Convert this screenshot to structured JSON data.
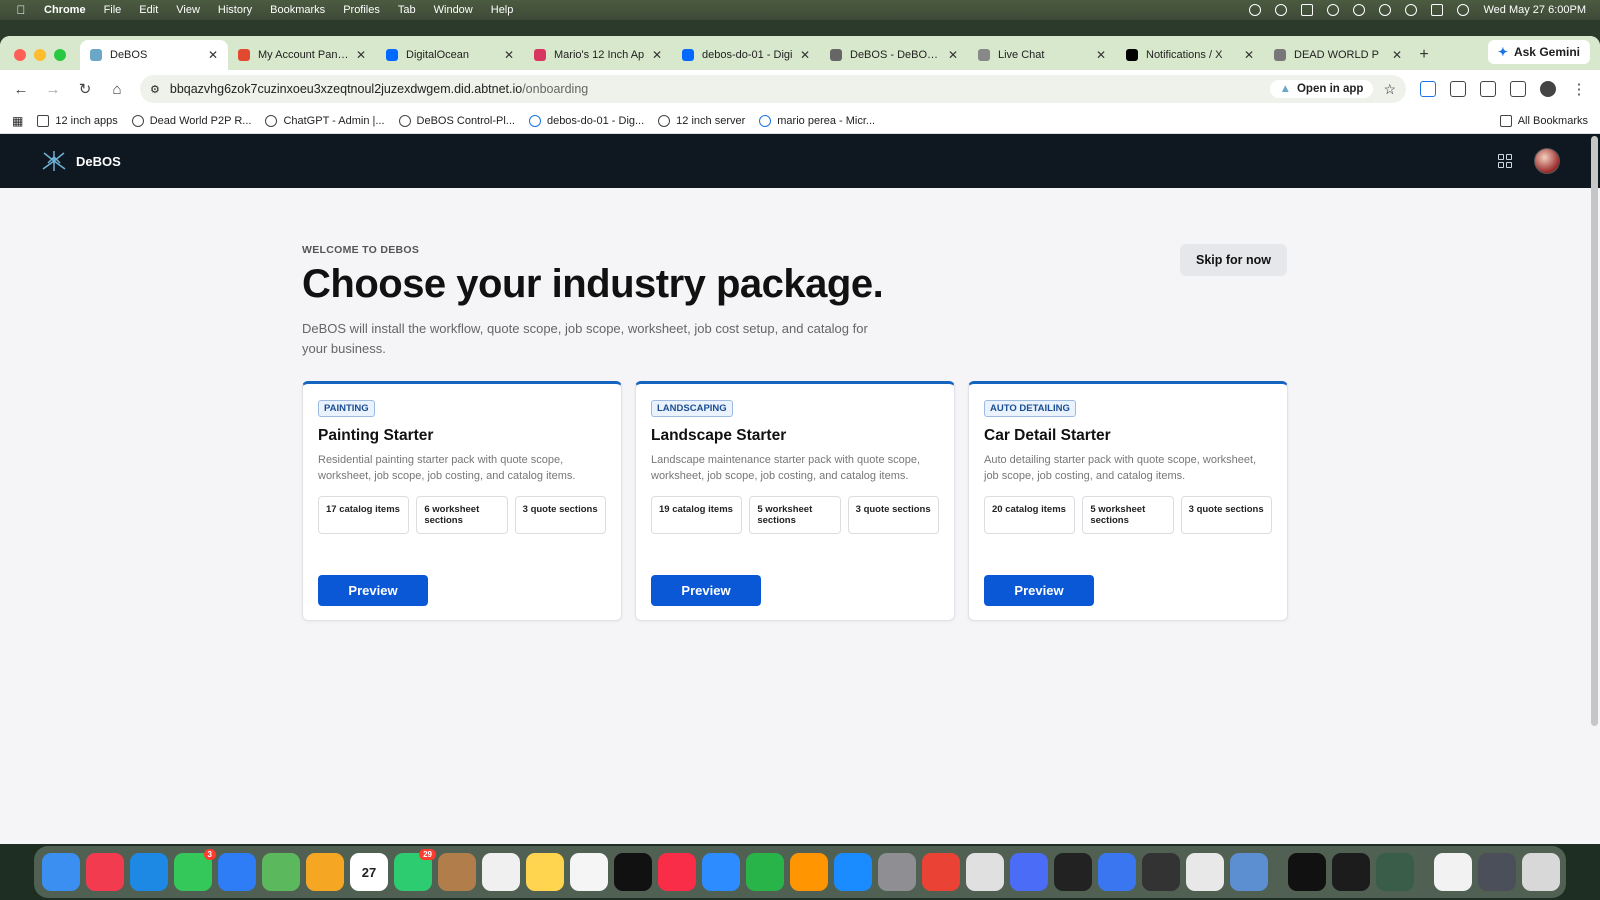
{
  "menubar": {
    "app": "Chrome",
    "items": [
      "File",
      "Edit",
      "View",
      "History",
      "Bookmarks",
      "Profiles",
      "Tab",
      "Window",
      "Help"
    ],
    "datetime": "Wed May 27  6:00PM"
  },
  "tabs": [
    {
      "label": "DeBOS",
      "color": "#6aa7c9"
    },
    {
      "label": "My Account Panel -",
      "color": "#e24a2f"
    },
    {
      "label": "DigitalOcean",
      "color": "#0069ff"
    },
    {
      "label": "Mario's 12 Inch Ap",
      "color": "#d8365f"
    },
    {
      "label": "debos-do-01 - Digi",
      "color": "#0069ff"
    },
    {
      "label": "DeBOS - DeBOS W",
      "color": "#666666"
    },
    {
      "label": "Live Chat",
      "color": "#888888"
    },
    {
      "label": "Notifications / X",
      "color": "#000000"
    },
    {
      "label": "DEAD WORLD P",
      "color": "#777777"
    }
  ],
  "gemini_label": "Ask Gemini",
  "toolbar": {
    "url": "bbqazvhg6zok7cuzinxoeu3xzeqtnoul2juzexdwgem.did.abtnet.io",
    "url_path": "/onboarding",
    "open_in_app": "Open in app"
  },
  "bookmarks": [
    {
      "label": "12 inch apps",
      "icon": "folder"
    },
    {
      "label": "Dead World P2P R...",
      "icon": "globe"
    },
    {
      "label": "ChatGPT - Admin |...",
      "icon": "globe"
    },
    {
      "label": "DeBOS Control-Pl...",
      "icon": "globe"
    },
    {
      "label": "debos-do-01 - Dig...",
      "icon": "digitalocean"
    },
    {
      "label": "12 inch server",
      "icon": "globe"
    },
    {
      "label": "mario perea - Micr...",
      "icon": "azure"
    }
  ],
  "all_bookmarks": "All Bookmarks",
  "app": {
    "brand": "DeBOS",
    "eyebrow": "WELCOME TO DEBOS",
    "title": "Choose your industry package.",
    "subtitle": "DeBOS will install the workflow, quote scope, job scope, worksheet, job cost setup, and catalog for your business.",
    "skip_label": "Skip for now",
    "preview_label": "Preview",
    "packages": [
      {
        "badge": "PAINTING",
        "title": "Painting Starter",
        "description": "Residential painting starter pack with quote scope, worksheet, job scope, job costing, and catalog items.",
        "stats": [
          "17 catalog items",
          "6 worksheet sections",
          "3 quote sections"
        ]
      },
      {
        "badge": "LANDSCAPING",
        "title": "Landscape Starter",
        "description": "Landscape maintenance starter pack with quote scope, worksheet, job scope, job costing, and catalog items.",
        "stats": [
          "19 catalog items",
          "5 worksheet sections",
          "3 quote sections"
        ]
      },
      {
        "badge": "AUTO DETAILING",
        "title": "Car Detail Starter",
        "description": "Auto detailing starter pack with quote scope, worksheet, job scope, job costing, and catalog items.",
        "stats": [
          "20 catalog items",
          "5 worksheet sections",
          "3 quote sections"
        ]
      }
    ]
  },
  "dock": {
    "apps": [
      {
        "name": "finder",
        "color": "#3b8ff0"
      },
      {
        "name": "news",
        "color": "#f23b4e"
      },
      {
        "name": "safari",
        "color": "#1e88e5"
      },
      {
        "name": "messages",
        "color": "#34c759",
        "badge": "3"
      },
      {
        "name": "mail",
        "color": "#2f7df6"
      },
      {
        "name": "maps",
        "color": "#5cb85c"
      },
      {
        "name": "photos",
        "color": "#f5a623"
      },
      {
        "name": "calendar",
        "color": "#ffffff",
        "text": "27"
      },
      {
        "name": "facetime",
        "color": "#2ecc71",
        "badge": "29"
      },
      {
        "name": "contacts",
        "color": "#b07d4b"
      },
      {
        "name": "reminders",
        "color": "#f0f0f0"
      },
      {
        "name": "notes",
        "color": "#ffd54f"
      },
      {
        "name": "freeform",
        "color": "#f5f5f5"
      },
      {
        "name": "tv",
        "color": "#111111"
      },
      {
        "name": "music",
        "color": "#fa2d48"
      },
      {
        "name": "keynote",
        "color": "#2d8cff"
      },
      {
        "name": "numbers",
        "color": "#29b44a"
      },
      {
        "name": "pages",
        "color": "#ff9500"
      },
      {
        "name": "app-store",
        "color": "#1a8cff"
      },
      {
        "name": "system-settings",
        "color": "#8e8e93"
      },
      {
        "name": "chrome",
        "color": "#ea4335"
      },
      {
        "name": "ipad-app",
        "color": "#e0e0e0"
      },
      {
        "name": "proton-vpn",
        "color": "#4a6cf7"
      },
      {
        "name": "cube-app",
        "color": "#222222"
      },
      {
        "name": "signal",
        "color": "#3a76f0"
      },
      {
        "name": "calculator",
        "color": "#333333"
      },
      {
        "name": "launchpad",
        "color": "#e8e8e8"
      },
      {
        "name": "preview",
        "color": "#5b8fd1"
      },
      {
        "name": "capcut",
        "color": "#111111"
      },
      {
        "name": "cube-app-2",
        "color": "#1c1c1c"
      },
      {
        "name": "debos",
        "color": "#3a5d4a"
      },
      {
        "name": "documents",
        "color": "#f2f2f2"
      },
      {
        "name": "screenshot",
        "color": "#4a4f5a"
      },
      {
        "name": "trash",
        "color": "#d8d8d8"
      }
    ]
  }
}
